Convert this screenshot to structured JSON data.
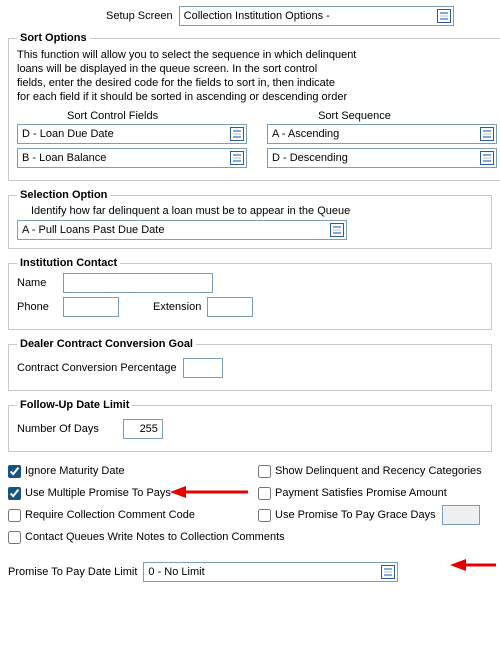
{
  "top": {
    "label": "Setup Screen",
    "value": "Collection Institution Options -"
  },
  "sort_options": {
    "legend": "Sort Options",
    "help1": "This function will allow you to select the sequence in which delinquent",
    "help2": "loans will be displayed in the queue screen.  In the sort control",
    "help3": "fields, enter the desired code for the fields to sort in, then indicate",
    "help4": "for each field if it should be sorted in ascending or descending order",
    "hdr_control": "Sort Control Fields",
    "hdr_sequence": "Sort Sequence",
    "row1_field": "D - Loan Due Date",
    "row1_seq": "A - Ascending",
    "row2_field": "B - Loan Balance",
    "row2_seq": "D - Descending"
  },
  "selection": {
    "legend": "Selection Option",
    "help": "Identify how far delinquent a loan must be to appear in the Queue",
    "value": "A - Pull Loans Past Due Date"
  },
  "contact": {
    "legend": "Institution Contact",
    "name_label": "Name",
    "name_value": "",
    "phone_label": "Phone",
    "phone_value": "",
    "ext_label": "Extension",
    "ext_value": ""
  },
  "dealer": {
    "legend": "Dealer Contract Conversion Goal",
    "pct_label": "Contract Conversion Percentage",
    "pct_value": ""
  },
  "followup": {
    "legend": "Follow-Up Date Limit",
    "days_label": "Number Of Days",
    "days_value": "255"
  },
  "options": {
    "ignore_maturity": "Ignore Maturity Date",
    "show_del_rec": "Show Delinquent and Recency Categories",
    "multi_ptp": "Use Multiple Promise To Pays",
    "pay_satisfies": "Payment Satisfies Promise Amount",
    "require_cc": "Require Collection Comment Code",
    "use_ptp_grace": "Use Promise To Pay Grace Days",
    "grace_value": "",
    "contact_queues": "Contact Queues Write Notes to Collection Comments",
    "checked": {
      "ignore_maturity": true,
      "multi_ptp": true
    }
  },
  "ptp_limit": {
    "label": "Promise To Pay Date Limit",
    "value": "0 - No Limit"
  }
}
